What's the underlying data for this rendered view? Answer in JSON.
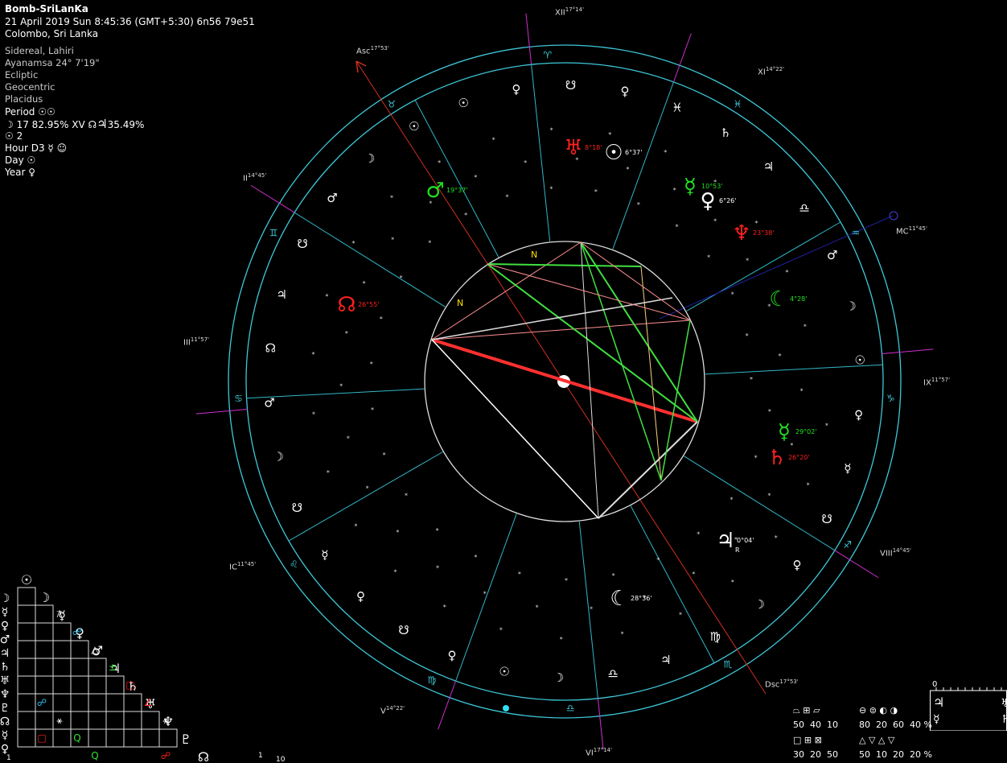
{
  "header": {
    "title": "Bomb-SriLanKa",
    "datetime": "21 April 2019  Sun   8:45:36 (GMT+5:30) 6n56  79e51",
    "place": "Colombo, Sri Lanka"
  },
  "settings": {
    "zodiac": "Sidereal, Lahiri",
    "ayanamsa": "Ayanamsa 24° 7'19\"",
    "plane": "Ecliptic",
    "centric": "Geocentric",
    "houses": "Placidus"
  },
  "period": {
    "period_label": "Period",
    "moon_line": "17 82.95% XV",
    "jupiter_pct": "35.49%",
    "sun_line": "2",
    "hour_label": "Hour D3",
    "day_label": "Day",
    "year_label": "Year"
  },
  "houses": [
    {
      "name": "Asc",
      "deg": "17°53'"
    },
    {
      "name": "XII",
      "deg": "17°14'"
    },
    {
      "name": "XI",
      "deg": "14°22'"
    },
    {
      "name": "MC",
      "deg": "11°45'"
    },
    {
      "name": "IX",
      "deg": "11°57'"
    },
    {
      "name": "VIII",
      "deg": "14°45'"
    },
    {
      "name": "Dsc",
      "deg": "17°53'"
    },
    {
      "name": "VI",
      "deg": "17°14'"
    },
    {
      "name": "V",
      "deg": "14°22'"
    },
    {
      "name": "IC",
      "deg": "11°45'"
    },
    {
      "name": "III",
      "deg": "11°57'"
    },
    {
      "name": "II",
      "deg": "14°45'"
    }
  ],
  "planets": [
    {
      "name": "Uranus",
      "glyph": "♅",
      "deg": "8°18'",
      "color": "#ff2020"
    },
    {
      "name": "Sun",
      "glyph": "☉",
      "deg": "6°37'",
      "color": "#ffffff"
    },
    {
      "name": "Mars",
      "glyph": "♂",
      "deg": "19°37'",
      "color": "#20e020"
    },
    {
      "name": "Mercury",
      "glyph": "☿",
      "deg": "10°53'",
      "color": "#20e020"
    },
    {
      "name": "Venus",
      "glyph": "♀",
      "deg": "6°26'",
      "color": "#ffffff"
    },
    {
      "name": "Neptune",
      "glyph": "♆",
      "deg": "23°38'",
      "color": "#ff2020"
    },
    {
      "name": "Node",
      "glyph": "☊",
      "deg": "26°55'",
      "color": "#ff2020"
    },
    {
      "name": "Moon",
      "glyph": "☾",
      "deg": "4°28'",
      "color": "#20e020"
    },
    {
      "name": "Mercury2",
      "glyph": "☿",
      "deg": "29°02'",
      "color": "#20e020"
    },
    {
      "name": "Saturn",
      "glyph": "♄",
      "deg": "26°20'",
      "color": "#ff2020"
    },
    {
      "name": "Jupiter",
      "glyph": "♃",
      "deg": "0°04'",
      "color": "#ffffff",
      "note": "R"
    },
    {
      "name": "Moon2",
      "glyph": "☾",
      "deg": "28°36'",
      "color": "#ffffff"
    }
  ],
  "stats": {
    "row1": [
      "50",
      "40",
      "10"
    ],
    "row1b": [
      "80",
      "20",
      "60",
      "40 %"
    ],
    "row2": [
      "30",
      "20",
      "50"
    ],
    "row2b": [
      "50",
      "10",
      "20",
      "20 %"
    ]
  },
  "grid_numbers": {
    "left": "1",
    "mid": "1",
    "right": "10",
    "scale_zero": "0"
  },
  "colors": {
    "ring": "#3ec8d8",
    "cusp": "#30b8c8",
    "angle": "#d030d0",
    "red": "#ff2020",
    "green": "#20e020"
  }
}
